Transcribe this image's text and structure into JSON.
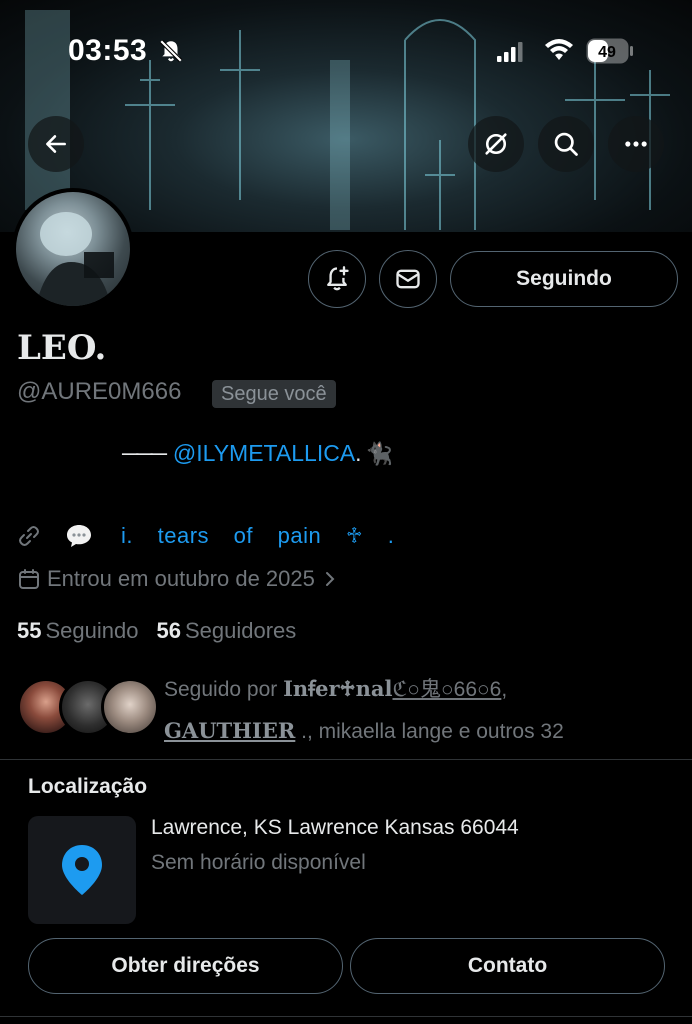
{
  "status_bar": {
    "time": "03:53",
    "battery": "49"
  },
  "profile": {
    "name": "LEO.",
    "handle": "@AURE0M666",
    "follows_you_label": "Segue você",
    "follow_button": "Seguindo",
    "bio": {
      "dash": "───",
      "mention": "@ILYMETALLICA",
      "suffix": ".",
      "emoji": "🐈‍⬛"
    },
    "link_text": "i. tears of pain ♱ .",
    "joined": "Entrou em outubro de 2025",
    "following_count": "55",
    "following_label": "Seguindo",
    "followers_count": "56",
    "followers_label": "Seguidores",
    "followed_by": {
      "prefix": "Seguido por ",
      "name1": "Inꞙer♱nal",
      "name1_tail": "ℭ○鬼○66○6",
      "name2": "GAUTHIER",
      "suffix": " ., mikaella lange e outros 32"
    }
  },
  "location": {
    "title": "Localização",
    "address": "Lawrence, KS Lawrence Kansas 66044",
    "hours": "Sem horário disponível",
    "directions_button": "Obter direções",
    "contact_button": "Contato"
  },
  "colors": {
    "accent": "#1d9bf0",
    "muted": "#71767b",
    "border": "#536471",
    "background": "#000000"
  }
}
